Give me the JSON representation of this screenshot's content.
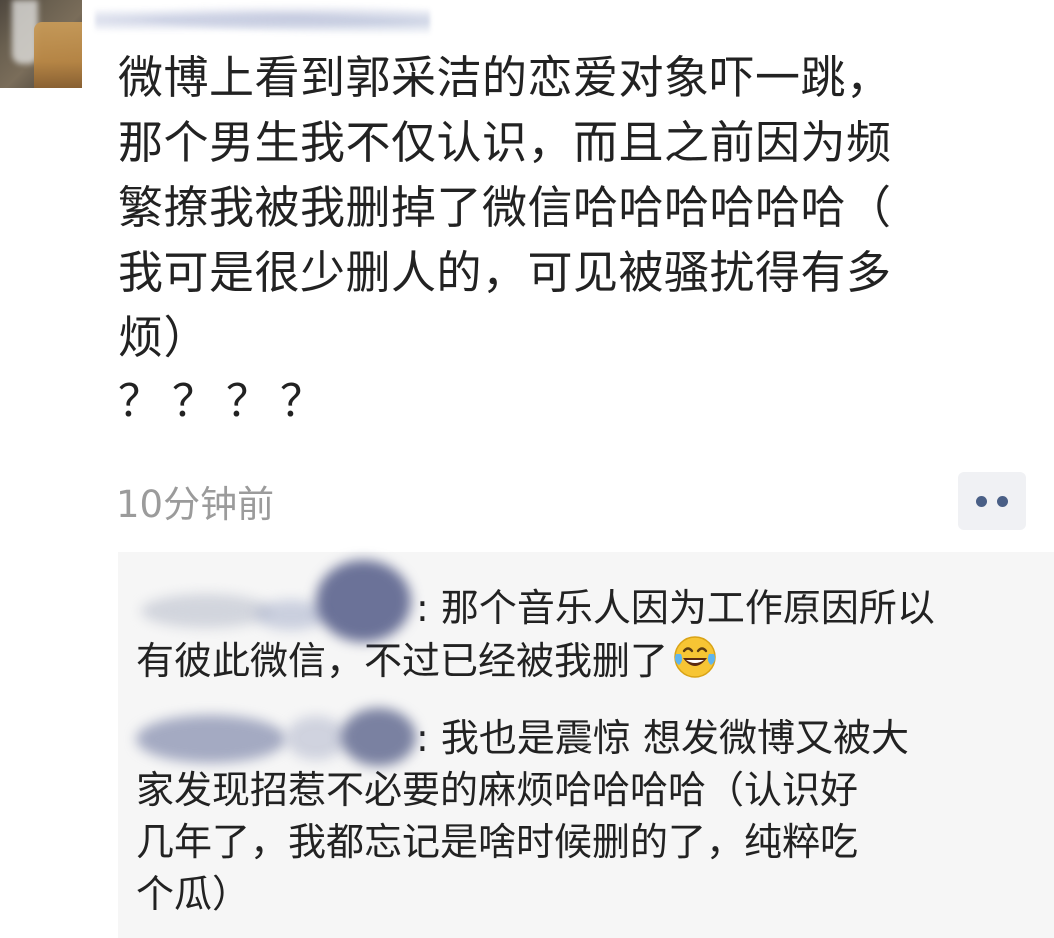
{
  "post": {
    "text": "微博上看到郭采洁的恋爱对象吓一跳，\n那个男生我不仅认识，而且之前因为频\n繁撩我被我删掉了微信哈哈哈哈哈哈（\n我可是很少删人的，可见被骚扰得有多\n烦）",
    "question_marks": "？？？？",
    "timestamp": "10分钟前"
  },
  "comments": [
    {
      "separator": ":",
      "text": " 那个音乐人因为工作原因所以\n有彼此微信，不过已经被我删了",
      "emoji": "laughing-tears-emoji"
    },
    {
      "separator": ":",
      "text": " 我也是震惊 想发微博又被大\n家发现招惹不必要的麻烦哈哈哈哈（认识好\n几年了，我都忘记是啥时候删的了，纯粹吃\n个瓜）"
    }
  ],
  "colors": {
    "text": "#222222",
    "timestamp": "#9b9b9b",
    "comment_background": "#f6f6f6",
    "more_dots": "#4a5f86"
  }
}
